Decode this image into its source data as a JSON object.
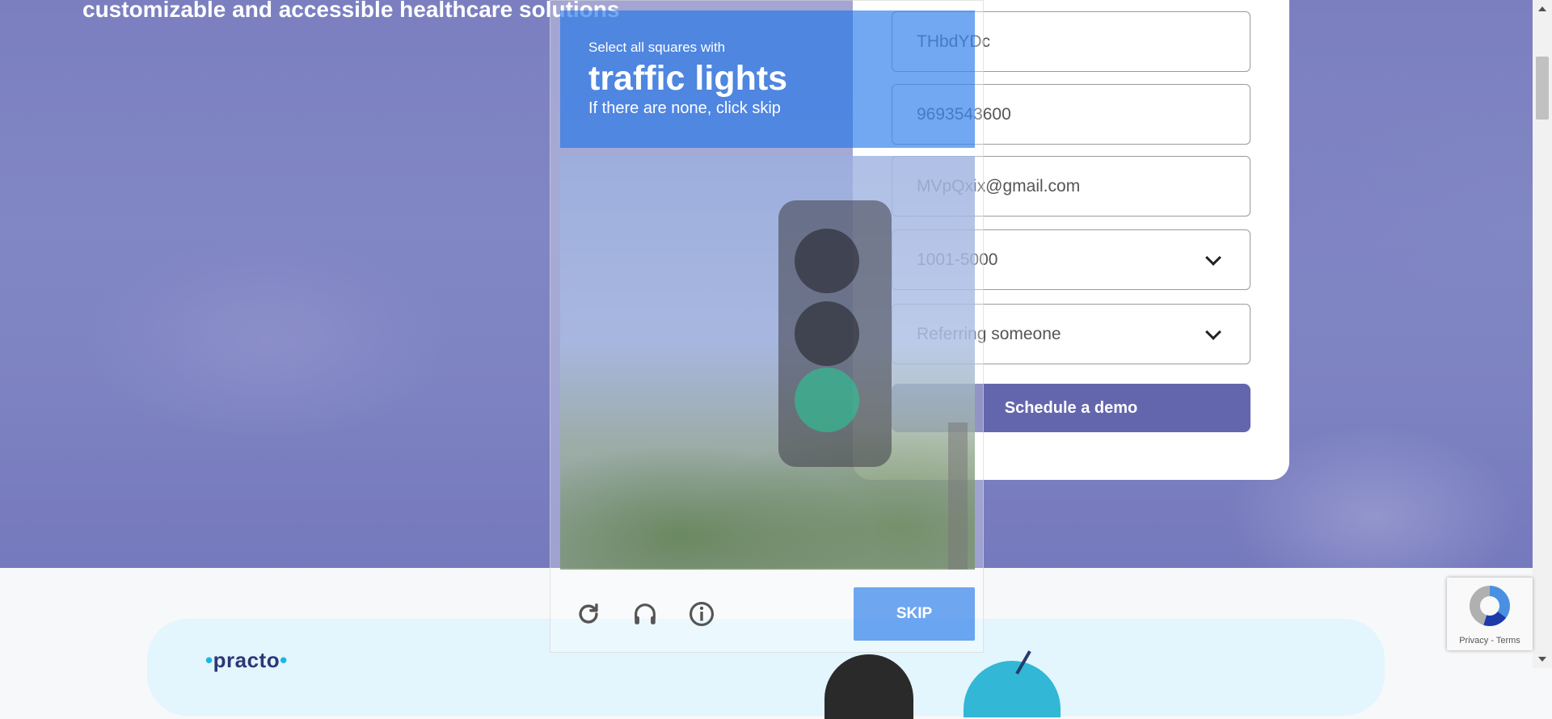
{
  "hero": {
    "title": "customizable and accessible healthcare solutions"
  },
  "form": {
    "name_value": "THbdYDc",
    "phone_value": "9693543600",
    "email_value": "MVpQxix@gmail.com",
    "size_value": "1001-5000",
    "reason_value": "Referring someone",
    "submit_label": "Schedule a demo"
  },
  "captcha": {
    "instruction": "Select all squares with",
    "target": "traffic lights",
    "hint": "If there are none, click skip",
    "tile_count": 16,
    "skip_label": "SKIP",
    "icons": [
      "reload-icon",
      "headphones-icon",
      "info-icon"
    ]
  },
  "banner": {
    "logo_text": "practo"
  },
  "recaptcha_badge": {
    "links": "Privacy - Terms"
  },
  "colors": {
    "hero_bg": "#7b7fc0",
    "demo_button": "#6466ad",
    "captcha_blue": "#1a73e8",
    "banner_bg": "#e3f5fd"
  }
}
